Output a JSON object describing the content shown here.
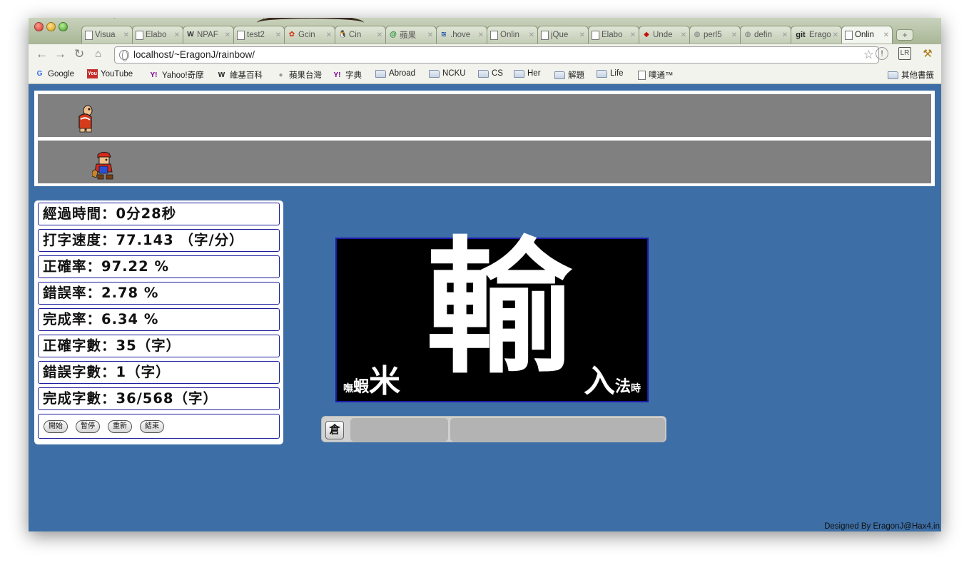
{
  "tabs": [
    {
      "title": "Visua",
      "icon": "doc",
      "active": false
    },
    {
      "title": "Elabo",
      "icon": "doc",
      "active": false
    },
    {
      "title": "NPAF",
      "icon": "wp",
      "active": false
    },
    {
      "title": "test2",
      "icon": "doc",
      "active": false
    },
    {
      "title": "Gcin",
      "icon": "paw",
      "active": false
    },
    {
      "title": "Cin",
      "icon": "tux",
      "active": false
    },
    {
      "title": "蘋果",
      "icon": "green",
      "active": false
    },
    {
      "title": ".hove",
      "icon": "blue",
      "active": false
    },
    {
      "title": "Onlin",
      "icon": "doc",
      "active": false
    },
    {
      "title": "jQue",
      "icon": "doc",
      "active": false
    },
    {
      "title": "Elabo",
      "icon": "doc",
      "active": false
    },
    {
      "title": "Unde",
      "icon": "red",
      "active": false
    },
    {
      "title": "perl5",
      "icon": "onion",
      "active": false
    },
    {
      "title": "defin",
      "icon": "onion",
      "active": false
    },
    {
      "title": "Erago",
      "icon": "git",
      "active": false
    },
    {
      "title": "Onlin",
      "icon": "doc",
      "active": true
    }
  ],
  "toolbar": {
    "url": "localhost/~EragonJ/rainbow/"
  },
  "bookmarks": [
    {
      "label": "Google",
      "icon": "G"
    },
    {
      "label": "YouTube",
      "icon": "YT"
    },
    {
      "label": "Yahoo!奇摩",
      "icon": "Y!"
    },
    {
      "label": "維基百科",
      "icon": "W"
    },
    {
      "label": "蘋果台灣",
      "icon": "apple"
    },
    {
      "label": "字典",
      "icon": "Y!"
    },
    {
      "label": "Abroad",
      "icon": "folder"
    },
    {
      "label": "NCKU",
      "icon": "folder"
    },
    {
      "label": "CS",
      "icon": "folder"
    },
    {
      "label": "Her",
      "icon": "folder"
    },
    {
      "label": "解題",
      "icon": "folder"
    },
    {
      "label": "Life",
      "icon": "folder"
    },
    {
      "label": "噗通™",
      "icon": "doc"
    }
  ],
  "other_bookmarks": "其他書籤",
  "stats": {
    "elapsed": "經過時間：0分28秒",
    "speed": "打字速度：77.143 （字/分）",
    "accuracy": "正確率：97.22 %",
    "error_rate": "錯誤率：2.78 %",
    "completion": "完成率：6.34 %",
    "correct_count": "正確字數：35（字）",
    "error_count": "錯誤字數：1（字）",
    "done_count": "完成字數：36/568（字）"
  },
  "controls": {
    "start": "開始",
    "pause": "暫停",
    "reset": "重新",
    "end": "結束"
  },
  "display": {
    "current_char": "輸",
    "wm_left_small": "嘸",
    "wm_left_mid": "蝦",
    "wm_left_big": "米",
    "wm_right_big": "入",
    "wm_right_mid": "法",
    "wm_right_small": "時"
  },
  "ime": {
    "mode_label": "倉",
    "composition": "",
    "candidates": ""
  },
  "footer": "Designed By EragonJ@Hax4.in"
}
